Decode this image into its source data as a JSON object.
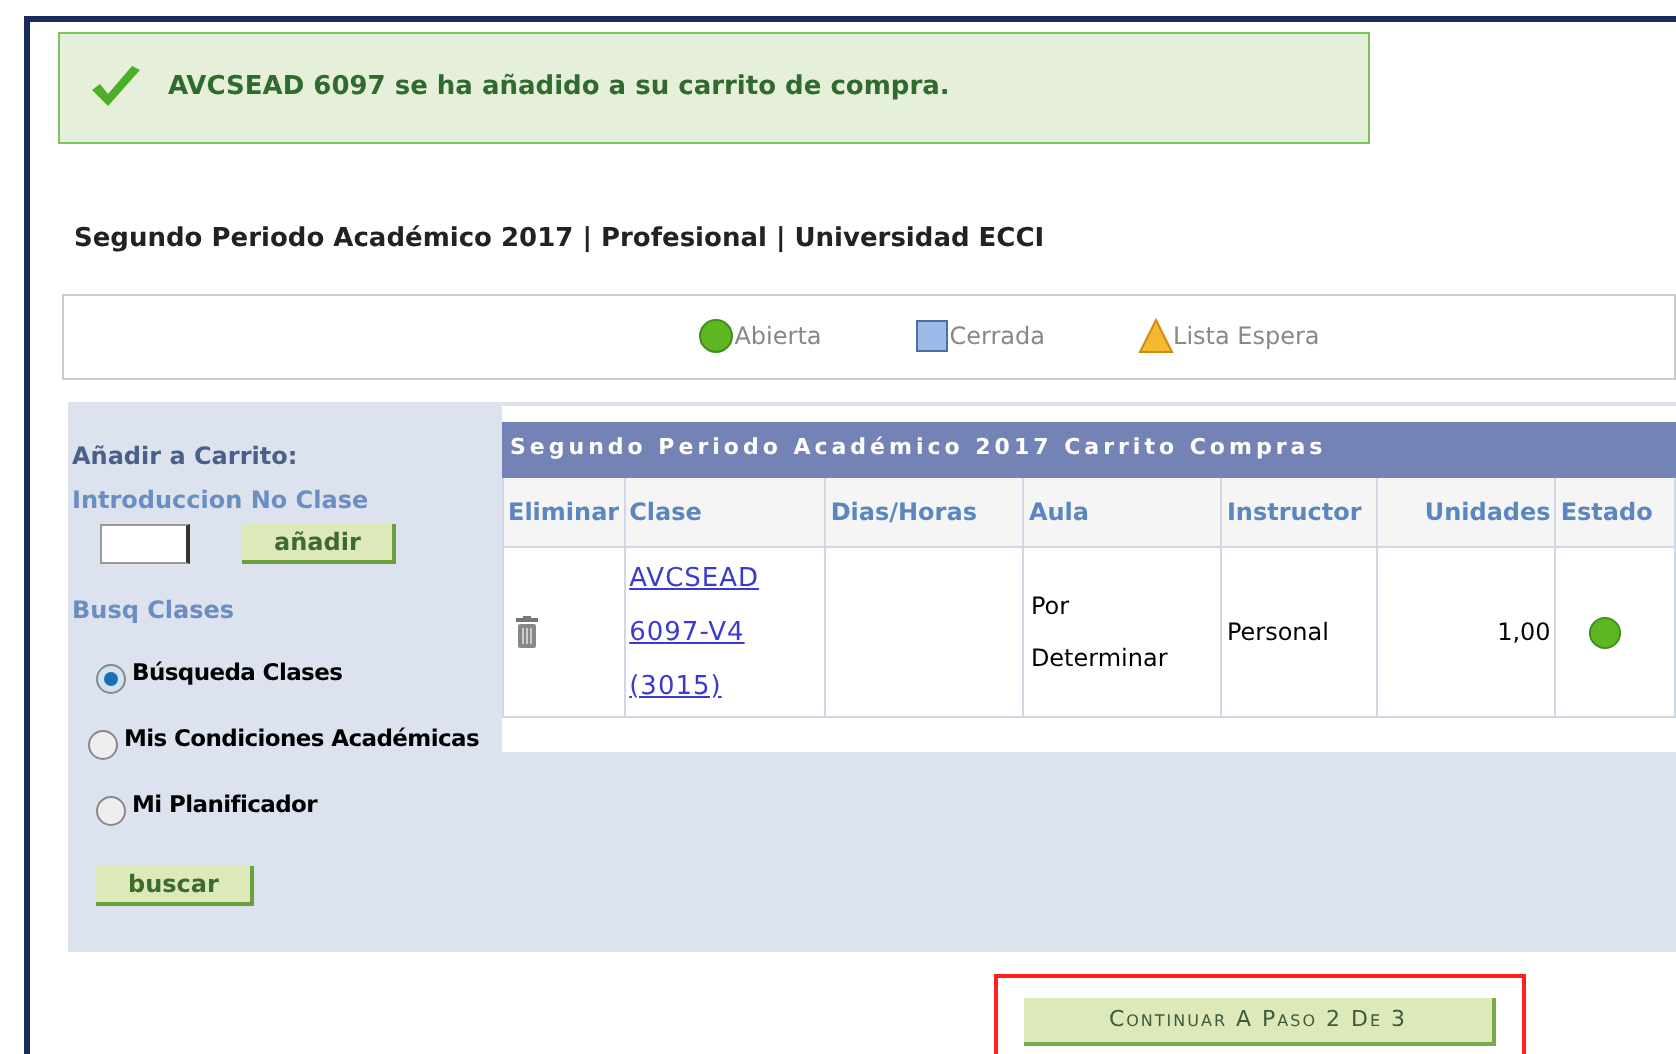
{
  "message": {
    "text": "AVCSEAD 6097 se ha añadido a su carrito de compra."
  },
  "term_title": "Segundo Periodo Académico 2017 | Profesional | Universidad ECCI",
  "legend": [
    {
      "kind": "circle",
      "label": "Abierta"
    },
    {
      "kind": "square",
      "label": "Cerrada"
    },
    {
      "kind": "triangle",
      "label": "Lista Espera"
    }
  ],
  "sidebar": {
    "heading": "Añadir a Carrito:",
    "class_number_label": "Introduccion No Clase",
    "add_button": "añadir",
    "search_label": "Busq Clases",
    "options": [
      {
        "label": "Búsqueda Clases",
        "selected": true
      },
      {
        "label": "Mis Condiciones Académicas",
        "selected": false
      },
      {
        "label": "Mi Planificador",
        "selected": false
      }
    ],
    "search_button": "buscar"
  },
  "cart": {
    "title": "Segundo Periodo Académico 2017 Carrito Compras",
    "columns": [
      "Eliminar",
      "Clase",
      "Dias/Horas",
      "Aula",
      "Instructor",
      "Unidades",
      "Estado"
    ],
    "rows": [
      {
        "class_lines": [
          "AVCSEAD",
          "6097-V4",
          "(3015)"
        ],
        "room_lines": [
          "Por",
          "Determinar"
        ],
        "instructor": "Personal",
        "units": "1,00",
        "open": true
      }
    ]
  },
  "continue_button": "Continuar A Paso 2 De 3"
}
